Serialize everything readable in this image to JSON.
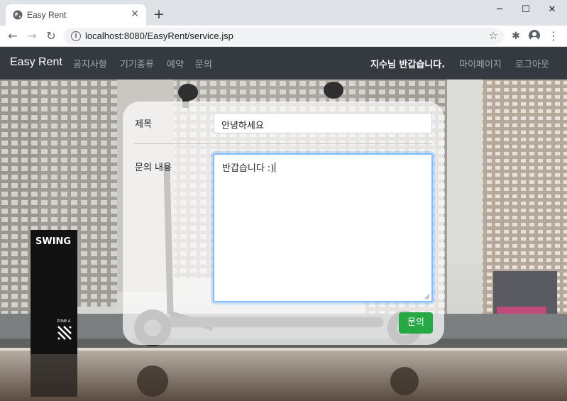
{
  "browser": {
    "tab_title": "Easy Rent",
    "tab_close_icon": "close-icon",
    "new_tab_icon": "plus-icon",
    "url": "localhost:8080/EasyRent/service.jsp",
    "window_controls": [
      "minimize-icon",
      "maximize-icon",
      "close-icon"
    ]
  },
  "navbar": {
    "brand": "Easy Rent",
    "links": [
      "공지사항",
      "기기종류",
      "예약",
      "문의"
    ],
    "greeting_name": "지수",
    "greeting_suffix": "님 반갑습니다.",
    "mypage": "마이페이지",
    "logout": "로그아웃"
  },
  "form": {
    "title_label": "제목",
    "title_value": "안녕하세요",
    "content_label": "문의 내용",
    "content_value": "반갑습니다 :)",
    "submit_label": "문의"
  },
  "background": {
    "sign_text": "SWING",
    "sign_zone": "ZONE A"
  },
  "colors": {
    "navbar": "#343a40",
    "submit": "#28a745",
    "focus_border": "#80bdff"
  }
}
